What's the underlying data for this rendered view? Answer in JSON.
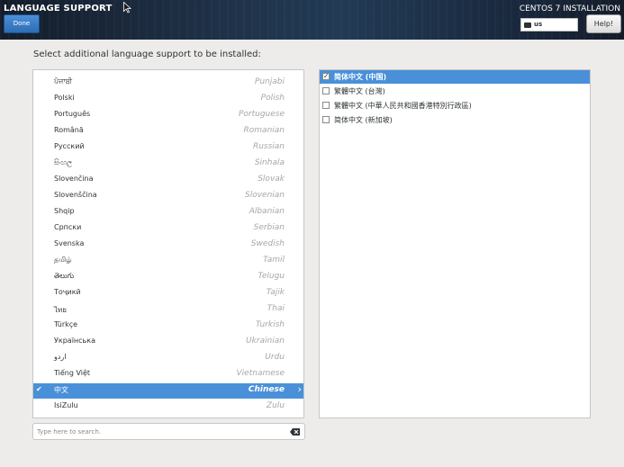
{
  "header": {
    "title": "LANGUAGE SUPPORT",
    "done_label": "Done",
    "install_title": "CENTOS 7 INSTALLATION",
    "keyboard_layout": "us",
    "help_label": "Help!"
  },
  "prompt": "Select additional language support to be installed:",
  "languages": [
    {
      "native": "ਪੰਜਾਬੀ",
      "english": "Punjabi",
      "selected": false
    },
    {
      "native": "Polski",
      "english": "Polish",
      "selected": false
    },
    {
      "native": "Português",
      "english": "Portuguese",
      "selected": false
    },
    {
      "native": "Română",
      "english": "Romanian",
      "selected": false
    },
    {
      "native": "Русский",
      "english": "Russian",
      "selected": false
    },
    {
      "native": "සිංහල",
      "english": "Sinhala",
      "selected": false
    },
    {
      "native": "Slovenčina",
      "english": "Slovak",
      "selected": false
    },
    {
      "native": "Slovenščina",
      "english": "Slovenian",
      "selected": false
    },
    {
      "native": "Shqip",
      "english": "Albanian",
      "selected": false
    },
    {
      "native": "Српски",
      "english": "Serbian",
      "selected": false
    },
    {
      "native": "Svenska",
      "english": "Swedish",
      "selected": false
    },
    {
      "native": "தமிழ்",
      "english": "Tamil",
      "selected": false
    },
    {
      "native": "తెలుగు",
      "english": "Telugu",
      "selected": false
    },
    {
      "native": "Тоҷикӣ",
      "english": "Tajik",
      "selected": false
    },
    {
      "native": "ไทย",
      "english": "Thai",
      "selected": false
    },
    {
      "native": "Türkçe",
      "english": "Turkish",
      "selected": false
    },
    {
      "native": "Українська",
      "english": "Ukrainian",
      "selected": false
    },
    {
      "native": "اردو",
      "english": "Urdu",
      "selected": false
    },
    {
      "native": "Tiếng Việt",
      "english": "Vietnamese",
      "selected": false
    },
    {
      "native": "中文",
      "english": "Chinese",
      "selected": true
    },
    {
      "native": "IsiZulu",
      "english": "Zulu",
      "selected": false
    }
  ],
  "locales": [
    {
      "label": "简体中文 (中国)",
      "checked": true,
      "selected": true
    },
    {
      "label": "繁體中文 (台灣)",
      "checked": false,
      "selected": false
    },
    {
      "label": "繁體中文 (中華人民共和國香港特別行政區)",
      "checked": false,
      "selected": false
    },
    {
      "label": "简体中文 (新加坡)",
      "checked": false,
      "selected": false
    }
  ],
  "search": {
    "placeholder": "Type here to search.",
    "value": ""
  },
  "colors": {
    "selection": "#4a90d9",
    "header_bg": "#1f3148",
    "background": "#edeceb"
  },
  "icons": {
    "check": "✔",
    "chevron": "›",
    "checkbox_checked": "✓"
  }
}
